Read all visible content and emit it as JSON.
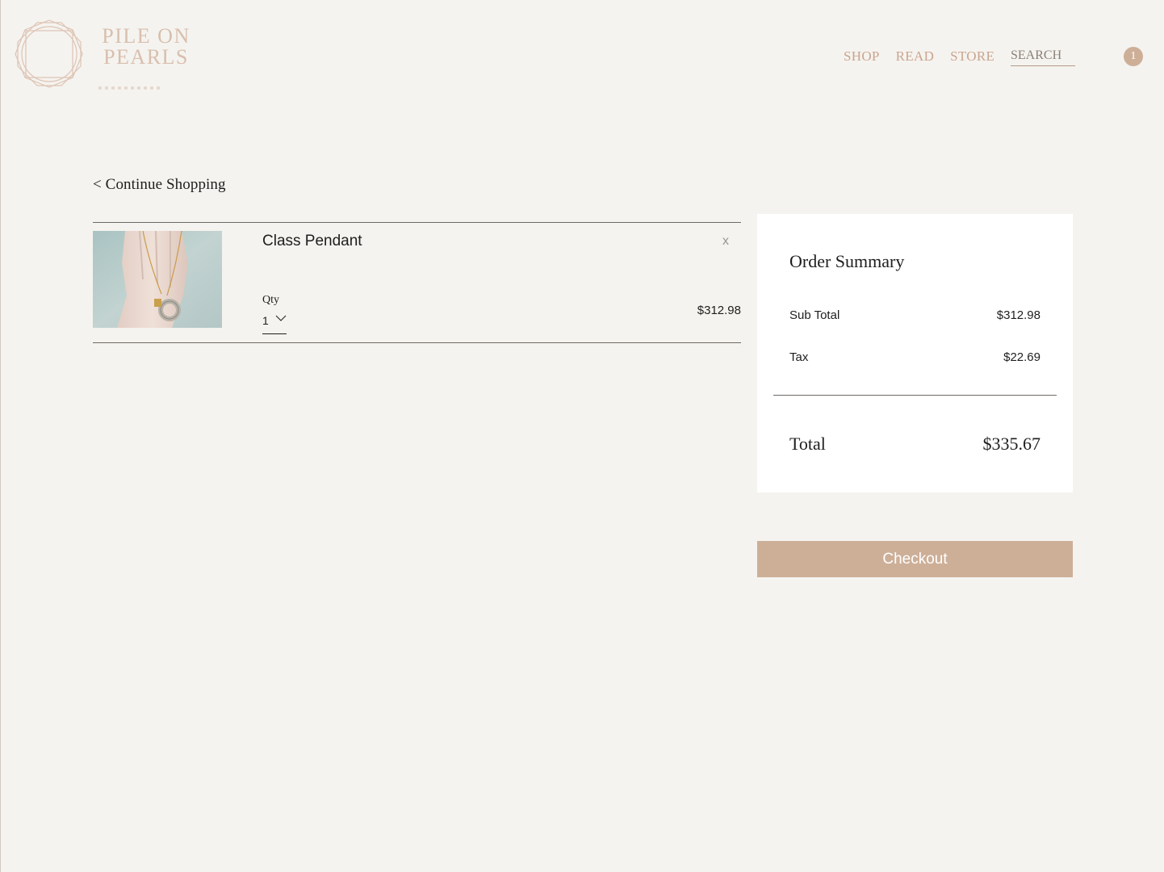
{
  "brand": {
    "line1": "PILE ON",
    "line2": "PEARLS"
  },
  "nav": {
    "items": [
      "SHOP",
      "READ",
      "STORE"
    ]
  },
  "search": {
    "placeholder": "SEARCH"
  },
  "cart": {
    "count": "1"
  },
  "page": {
    "continue_label": "< Continue Shopping"
  },
  "cart_items": [
    {
      "name": "Class Pendant",
      "remove_label": "x",
      "qty_label": "Qty",
      "qty": "1",
      "price": "$312.98"
    }
  ],
  "summary": {
    "title": "Order Summary",
    "subtotal_label": "Sub Total",
    "subtotal_value": "$312.98",
    "tax_label": "Tax",
    "tax_value": "$22.69",
    "total_label": "Total",
    "total_value": "$335.67"
  },
  "checkout": {
    "label": "Checkout"
  },
  "colors": {
    "background": "#f5f3ef",
    "accent": "#cdaf98",
    "nav_text": "#c9a58e",
    "panel": "#ffffff"
  },
  "icons": {
    "logo": "octagon-logo-icon",
    "qty_dropdown": "chevron-down-icon"
  }
}
